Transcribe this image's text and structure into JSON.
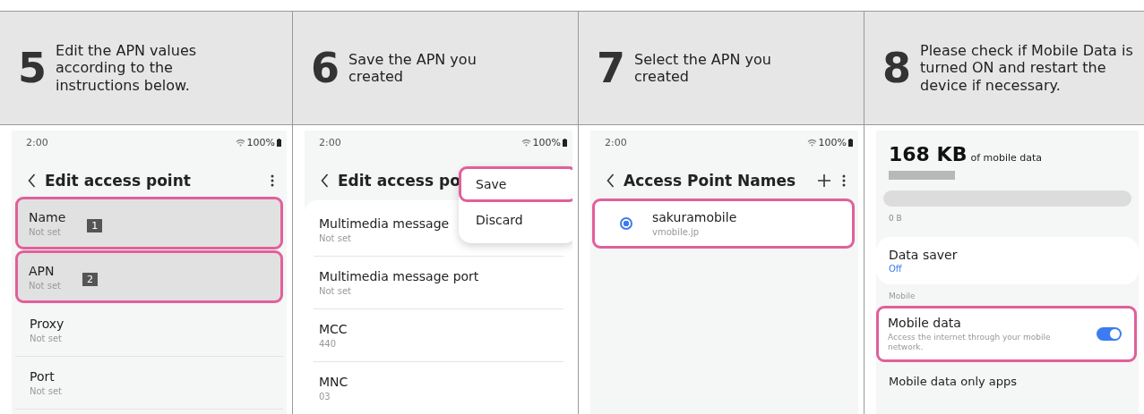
{
  "steps": [
    {
      "number": "5",
      "instruction": "Edit the APN values according to the instructions below.",
      "screen": {
        "kind": "settings_list",
        "status": {
          "time": "2:00",
          "battery": "100%"
        },
        "title": "Edit access point",
        "more_icon": true,
        "rows": [
          {
            "label": "Name",
            "value": "Not set",
            "highlighted": true,
            "badge": "1"
          },
          {
            "label": "APN",
            "value": "Not set",
            "highlighted": true,
            "badge": "2"
          },
          {
            "label": "Proxy",
            "value": "Not set",
            "highlighted": false
          },
          {
            "label": "Port",
            "value": "Not set",
            "highlighted": false
          }
        ]
      }
    },
    {
      "number": "6",
      "instruction": "Save the APN you created",
      "screen": {
        "kind": "settings_list",
        "card": true,
        "status": {
          "time": "2:00",
          "battery": "100%"
        },
        "title": "Edit access po",
        "rows": [
          {
            "label": "Multimedia message",
            "value": "Not set",
            "highlighted": false
          },
          {
            "label": "Multimedia message port",
            "value": "Not set",
            "highlighted": false
          },
          {
            "label": "MCC",
            "value": "440",
            "highlighted": false
          },
          {
            "label": "MNC",
            "value": "03",
            "highlighted": false
          }
        ],
        "menu": [
          {
            "label": "Save",
            "highlighted": true
          },
          {
            "label": "Discard",
            "highlighted": false
          }
        ]
      }
    },
    {
      "number": "7",
      "instruction": "Select the APN you created",
      "screen": {
        "kind": "apn_list",
        "status": {
          "time": "2:00",
          "battery": "100%"
        },
        "title": "Access Point Names",
        "more_icon": true,
        "add_icon": true,
        "items": [
          {
            "name": "sakuramobile",
            "apn": "vmobile.jp",
            "selected": true,
            "highlighted": true
          }
        ]
      }
    },
    {
      "number": "8",
      "instruction": "Please check if Mobile Data is turned ON and restart the device if necessary.",
      "screen": {
        "kind": "data_usage",
        "amount": "168 KB",
        "amount_caption": "of mobile data",
        "level": 0,
        "scale_label": "0 B",
        "saver": {
          "label": "Data saver",
          "value": "Off"
        },
        "section": "Mobile",
        "toggle": {
          "label": "Mobile data",
          "description": "Access the internet through your mobile network.",
          "on": true,
          "highlighted": true
        },
        "next_item": "Mobile data only apps"
      }
    }
  ]
}
